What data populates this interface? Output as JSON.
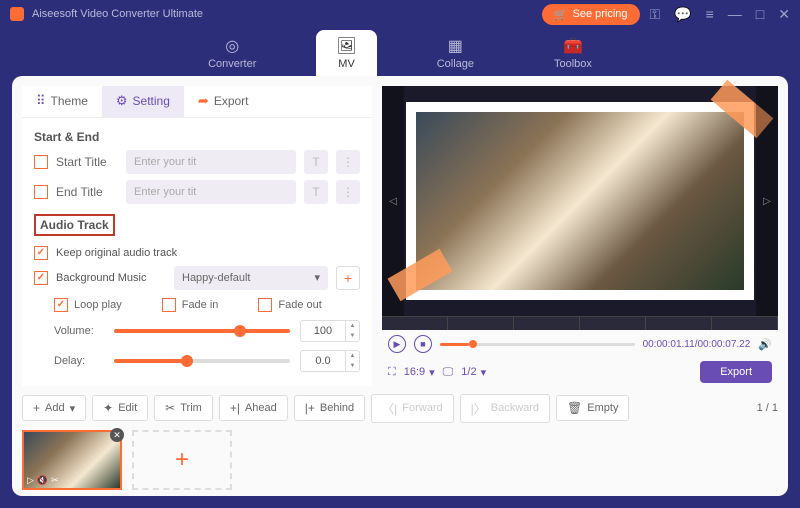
{
  "app": {
    "title": "Aiseesoft Video Converter Ultimate",
    "see_pricing": "See pricing"
  },
  "nav": {
    "converter": "Converter",
    "mv": "MV",
    "collage": "Collage",
    "toolbox": "Toolbox"
  },
  "tabs": {
    "theme": "Theme",
    "setting": "Setting",
    "export": "Export"
  },
  "settings": {
    "start_end": "Start & End",
    "start_title": "Start Title",
    "end_title": "End Title",
    "placeholder": "Enter your tit",
    "audio_track": "Audio Track",
    "keep_original": "Keep original audio track",
    "bg_music": "Background Music",
    "bg_music_value": "Happy-default",
    "loop_play": "Loop play",
    "fade_in": "Fade in",
    "fade_out": "Fade out",
    "volume_label": "Volume:",
    "volume_value": "100",
    "delay_label": "Delay:",
    "delay_value": "0.0"
  },
  "preview": {
    "time_current": "00:00:01.11",
    "time_total": "00:00:07.22",
    "aspect": "16:9",
    "frac": "1/2",
    "export": "Export"
  },
  "toolbar": {
    "add": "Add",
    "edit": "Edit",
    "trim": "Trim",
    "ahead": "Ahead",
    "behind": "Behind",
    "forward": "Forward",
    "backward": "Backward",
    "empty": "Empty",
    "page": "1 / 1"
  }
}
